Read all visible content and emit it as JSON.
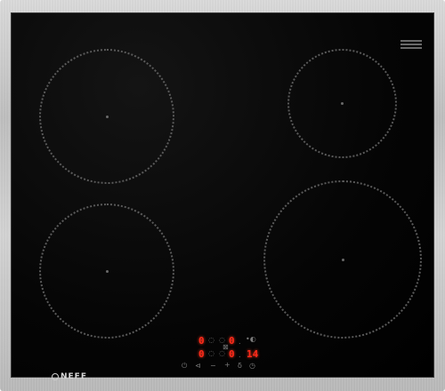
{
  "brand": {
    "name": "NEFF"
  },
  "badge": {
    "fine_print": ""
  },
  "displays": {
    "front_left": "0",
    "rear_left": "0",
    "rear_right": "0",
    "front_right": "0",
    "timer": "14"
  },
  "controls": {
    "power_icon": "power-icon",
    "minus_label": "−",
    "plus_label": "+",
    "timer_icon": "timer-icon",
    "lock_icon": "lock-icon",
    "boost_icon": "boost-icon"
  },
  "colors": {
    "glass": "#000000",
    "frame": "#c8c8c8",
    "display": "#ff2a1a"
  }
}
